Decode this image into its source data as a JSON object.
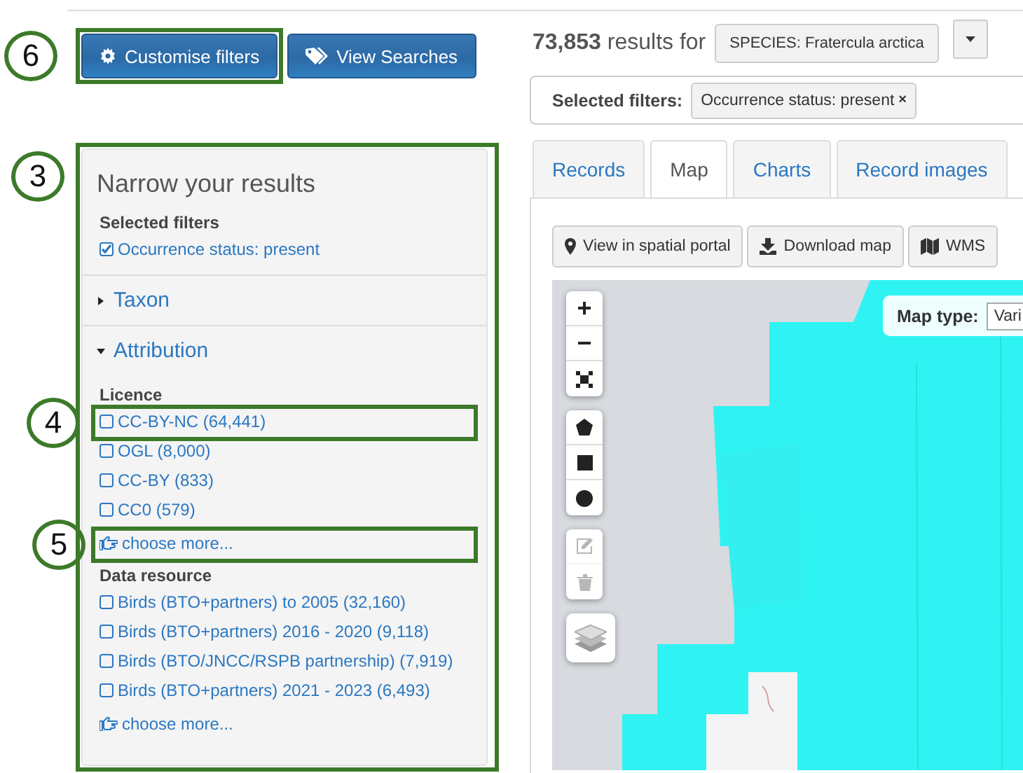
{
  "toolbar": {
    "buttons": [
      {
        "label": "Customise filters",
        "kind": "gear",
        "callout": "6"
      },
      {
        "label": "View Searches",
        "kind": "tags"
      }
    ]
  },
  "facets": {
    "callout": "3",
    "title": "Narrow your results",
    "selected_heading": "Selected filters",
    "selected_filters": [
      {
        "label": "Occurrence status: present",
        "checked": true
      }
    ],
    "sections": [
      {
        "title": "Taxon",
        "expanded": false
      },
      {
        "title": "Attribution",
        "expanded": true,
        "groups": [
          {
            "heading": "Licence",
            "items": [
              {
                "label": "CC-BY-NC (64,441)",
                "checked": false,
                "callout": "4"
              },
              {
                "label": "OGL (8,000)",
                "checked": false
              },
              {
                "label": "CC-BY (833)",
                "checked": false
              },
              {
                "label": "CC0 (579)",
                "checked": false
              }
            ],
            "more": {
              "label": "choose more...",
              "callout": "5"
            }
          },
          {
            "heading": "Data resource",
            "items": [
              {
                "label": "Birds (BTO+partners) to 2005 (32,160)",
                "checked": false
              },
              {
                "label": "Birds (BTO+partners) 2016 - 2020 (9,118)",
                "checked": false
              },
              {
                "label": "Birds (BTO/JNCC/RSPB partnership) (7,919)",
                "checked": false
              },
              {
                "label": "Birds (BTO+partners) 2021 - 2023 (6,493)",
                "checked": false
              }
            ],
            "more": {
              "label": "choose more..."
            }
          }
        ]
      }
    ]
  },
  "results": {
    "count": "73,853",
    "suffix": "results for",
    "query": "SPECIES: Fratercula arctica"
  },
  "filter_bar": {
    "label": "Selected filters:",
    "chips": [
      {
        "label": "Occurrence status: present",
        "remove": "×"
      }
    ]
  },
  "tabs": [
    {
      "label": "Records",
      "selected": false
    },
    {
      "label": "Map",
      "selected": true
    },
    {
      "label": "Charts",
      "selected": false
    },
    {
      "label": "Record images",
      "selected": false
    }
  ],
  "map_actions": [
    {
      "label": "View in spatial portal",
      "kind": "pin"
    },
    {
      "label": "Download map",
      "kind": "download"
    },
    {
      "label": "WMS",
      "kind": "map"
    }
  ],
  "map": {
    "zoom_in": "+",
    "zoom_out": "−",
    "draw_tools": [
      {
        "kind": "polygon"
      },
      {
        "kind": "square"
      },
      {
        "kind": "circle"
      }
    ],
    "edit_tools": [
      {
        "kind": "edit",
        "disabled": true
      },
      {
        "kind": "delete",
        "disabled": true
      }
    ],
    "map_type": {
      "label": "Map type:",
      "value": "Vari"
    }
  }
}
